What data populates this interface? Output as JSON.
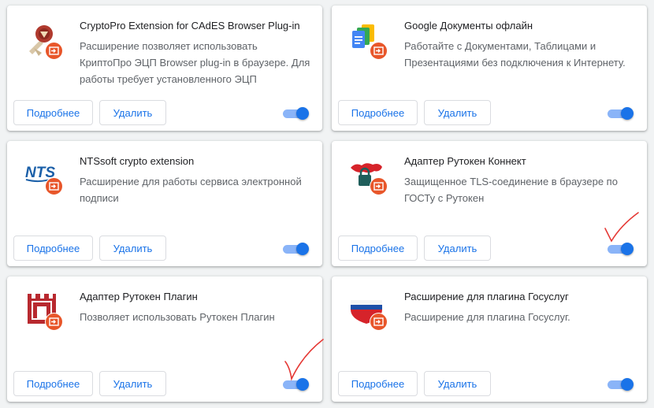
{
  "extensions": [
    {
      "title": "CryptoPro Extension for CAdES Browser Plug-in",
      "description": "Расширение позволяет использовать КриптоПро ЭЦП Browser plug-in в браузере. Для работы требует установленного ЭЦП",
      "details_label": "Подробнее",
      "remove_label": "Удалить",
      "enabled": true
    },
    {
      "title": "Google Документы офлайн",
      "description": "Работайте с Документами, Таблицами и Презентациями без подключения к Интернету.",
      "details_label": "Подробнее",
      "remove_label": "Удалить",
      "enabled": true
    },
    {
      "title": "NTSsoft crypto extension",
      "description": "Расширение для работы сервиса электронной подписи",
      "details_label": "Подробнее",
      "remove_label": "Удалить",
      "enabled": true
    },
    {
      "title": "Адаптер Рутокен Коннект",
      "description": "Защищенное TLS-соединение в браузере по ГОСТу с Рутокен",
      "details_label": "Подробнее",
      "remove_label": "Удалить",
      "enabled": true
    },
    {
      "title": "Адаптер Рутокен Плагин",
      "description": "Позволяет использовать Рутокен Плагин",
      "details_label": "Подробнее",
      "remove_label": "Удалить",
      "enabled": true
    },
    {
      "title": "Расширение для плагина Госуслуг",
      "description": "Расширение для плагина Госуслуг.",
      "details_label": "Подробнее",
      "remove_label": "Удалить",
      "enabled": true
    }
  ],
  "colors": {
    "accent": "#1a73e8",
    "badge": "#e8562a",
    "annotation": "#e53935"
  }
}
